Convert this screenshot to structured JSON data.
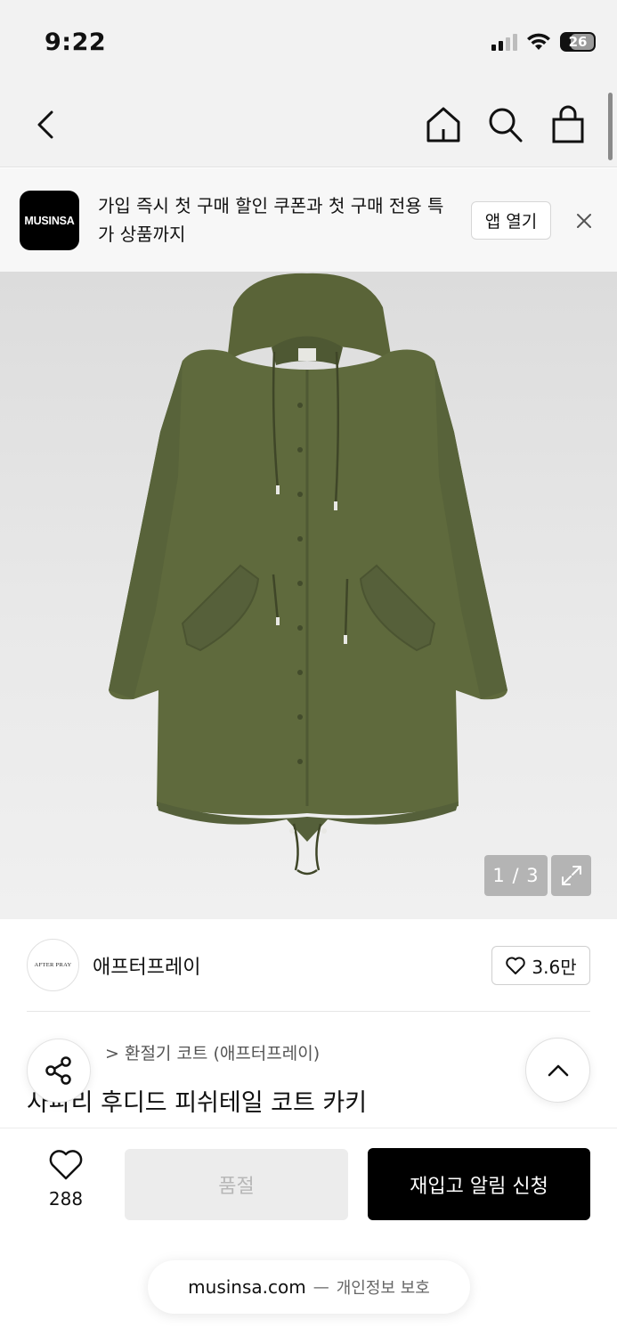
{
  "status_bar": {
    "time": "9:22",
    "battery": "26"
  },
  "banner": {
    "logo_text": "MUSINSA",
    "message": "가입 즉시 첫 구매 할인 쿠폰과 첫 구매 전용 특가 상품까지",
    "open_app_label": "앱 열기"
  },
  "gallery": {
    "counter": "1 / 3"
  },
  "brand": {
    "logo_text": "AFTER PRAY",
    "name": "애프터프레이",
    "likes": "3.6만"
  },
  "product": {
    "breadcrumb": "> 환절기 코트 (애프터프레이)",
    "title": "사파리 후디드 피쉬테일 코트 카키"
  },
  "actions": {
    "wish_count": "288",
    "soldout_label": "품절",
    "restock_label": "재입고 알림 신청"
  },
  "url_bar": {
    "domain": "musinsa.com",
    "separator": "—",
    "suffix": "개인정보 보호"
  },
  "colors": {
    "coat": "#5f6a3d",
    "primary_button": "#000000",
    "soldout_button": "#ececec"
  }
}
